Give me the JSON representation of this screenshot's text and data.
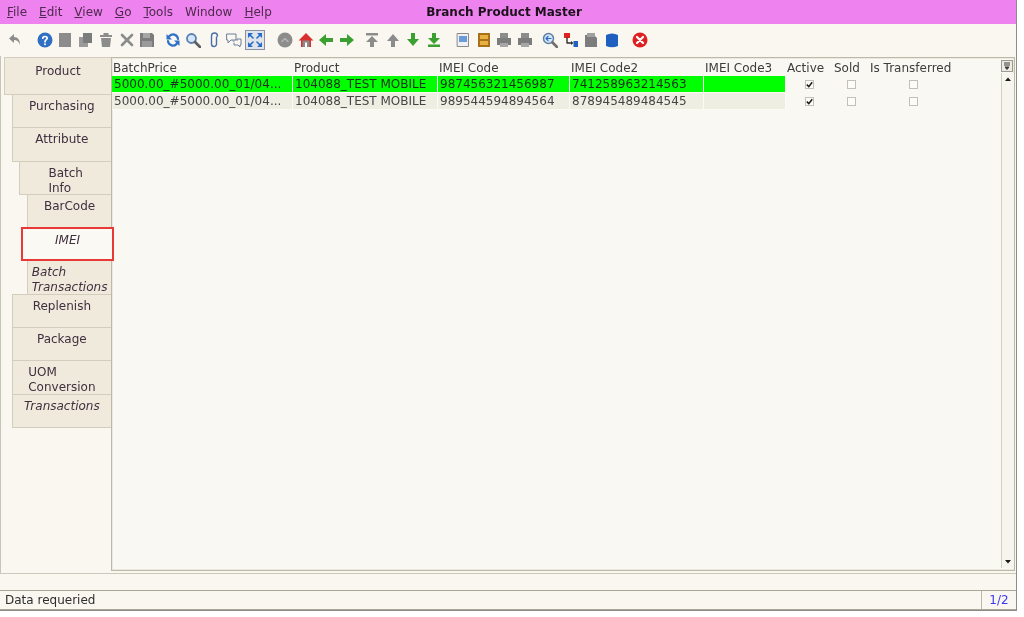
{
  "window": {
    "title": "Branch Product Master"
  },
  "menu": [
    {
      "label": "File",
      "mnemonic": true
    },
    {
      "label": "Edit",
      "mnemonic": true
    },
    {
      "label": "View",
      "mnemonic": true
    },
    {
      "label": "Go",
      "mnemonic": true
    },
    {
      "label": "Tools",
      "mnemonic": true
    },
    {
      "label": "Window",
      "mnemonic": false
    },
    {
      "label": "Help",
      "mnemonic": true
    }
  ],
  "toolbar": [
    {
      "disabled": true,
      "pressed": false
    },
    {
      "disabled": false,
      "pressed": false
    },
    {
      "disabled": true,
      "pressed": false
    },
    {
      "disabled": true,
      "pressed": false
    },
    {
      "disabled": true,
      "pressed": false
    },
    {
      "disabled": true,
      "pressed": false
    },
    {
      "disabled": true,
      "pressed": false
    },
    {
      "disabled": false,
      "pressed": false
    },
    {
      "disabled": false,
      "pressed": false
    },
    {
      "disabled": false,
      "pressed": false
    },
    {
      "disabled": false,
      "pressed": false
    },
    {
      "disabled": false,
      "pressed": true
    },
    {
      "disabled": true,
      "pressed": false
    },
    {
      "disabled": false,
      "pressed": false
    },
    {
      "disabled": false,
      "pressed": false
    },
    {
      "disabled": false,
      "pressed": false
    },
    {
      "disabled": true,
      "pressed": false
    },
    {
      "disabled": true,
      "pressed": false
    },
    {
      "disabled": false,
      "pressed": false
    },
    {
      "disabled": false,
      "pressed": false
    },
    {
      "disabled": false,
      "pressed": false
    },
    {
      "disabled": false,
      "pressed": false
    },
    {
      "disabled": true,
      "pressed": false
    },
    {
      "disabled": true,
      "pressed": false
    },
    {
      "disabled": false,
      "pressed": false
    },
    {
      "disabled": false,
      "pressed": false
    },
    {
      "disabled": true,
      "pressed": false
    },
    {
      "disabled": false,
      "pressed": false
    },
    {
      "disabled": false,
      "pressed": false
    }
  ],
  "tabs": [
    {
      "label": "Product",
      "selected": false,
      "italic": false,
      "children": [
        {
          "label": "Purchasing",
          "selected": false,
          "italic": false
        },
        {
          "label": "Attribute",
          "selected": false,
          "italic": false,
          "children": [
            {
              "label": "Batch\nInfo",
              "selected": false,
              "italic": false,
              "children": [
                {
                  "label": "BarCode",
                  "selected": false,
                  "italic": false
                },
                {
                  "label": "IMEI",
                  "selected": true,
                  "italic": true
                },
                {
                  "label": "Batch\nTransactions",
                  "selected": false,
                  "italic": true
                }
              ]
            }
          ]
        },
        {
          "label": "Replenish",
          "selected": false,
          "italic": false
        },
        {
          "label": "Package",
          "selected": false,
          "italic": false
        },
        {
          "label": "UOM\nConversion",
          "selected": false,
          "italic": false
        },
        {
          "label": "Transactions",
          "selected": false,
          "italic": true
        }
      ]
    }
  ],
  "table": {
    "columns": [
      {
        "label": "BatchPrice",
        "kind": "text"
      },
      {
        "label": "Product",
        "kind": "text"
      },
      {
        "label": "IMEI Code",
        "kind": "text"
      },
      {
        "label": "IMEI Code2",
        "kind": "text"
      },
      {
        "label": "IMEI Code3",
        "kind": "text"
      },
      {
        "label": "Active",
        "kind": "check"
      },
      {
        "label": "Sold",
        "kind": "check"
      },
      {
        "label": "Is Transferred",
        "kind": "check"
      }
    ],
    "rows": [
      {
        "selected": true,
        "texts": [
          "5000.00_#5000.00_01/04...",
          "104088_TEST MOBILE",
          "987456321456987",
          "741258963214563"
        ],
        "checks": [
          {
            "checked": true
          },
          {
            "checked": false
          },
          {
            "checked": false
          }
        ]
      },
      {
        "selected": false,
        "texts": [
          "5000.00_#5000.00_01/04...",
          "104088_TEST MOBILE",
          "989544594894564",
          "878945489484545"
        ],
        "checks": [
          {
            "checked": true
          },
          {
            "checked": false
          },
          {
            "checked": false
          }
        ]
      }
    ]
  },
  "status_bar": {
    "message": "Data requeried",
    "page": "1/2"
  }
}
